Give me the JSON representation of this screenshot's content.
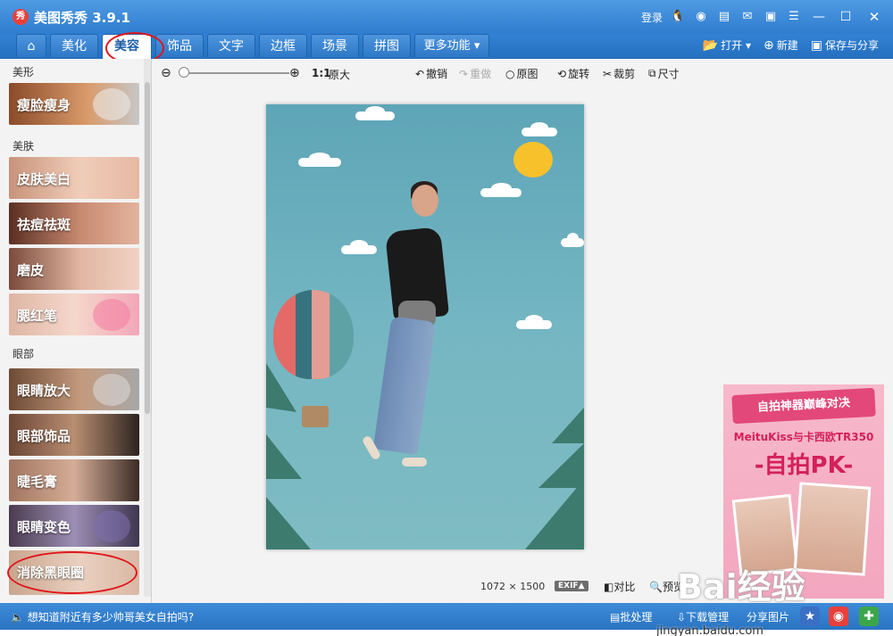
{
  "window": {
    "title": "美图秀秀 3.9.1",
    "logo_text": "秀",
    "login_label": "登录",
    "controls": {
      "minimize": "—",
      "maximize": "☐",
      "close": "✕"
    }
  },
  "nav": {
    "home_icon": "home-icon",
    "tabs": [
      "美化",
      "美容",
      "饰品",
      "文字",
      "边框",
      "场景",
      "拼图"
    ],
    "active_tab": "美容",
    "more_label": "更多功能",
    "more_caret": "▾",
    "open_label": "打开",
    "open_caret": "▾",
    "new_label": "新建",
    "save_label": "保存与分享"
  },
  "left_panel": {
    "sections": [
      {
        "label": "美形",
        "items": [
          "瘦脸瘦身"
        ]
      },
      {
        "label": "美肤",
        "items": [
          "皮肤美白",
          "祛痘祛斑",
          "磨皮",
          "腮红笔"
        ]
      },
      {
        "label": "眼部",
        "items": [
          "眼睛放大",
          "眼部饰品",
          "睫毛膏",
          "眼睛变色",
          "消除黑眼圈"
        ]
      }
    ]
  },
  "toolbar": {
    "zoom_11": "1:1",
    "zoom_orig": "原大",
    "undo": "撤销",
    "redo": "重做",
    "original": "原图",
    "rotate": "旋转",
    "crop": "裁剪",
    "size": "尺寸"
  },
  "image": {
    "width_px": "1072",
    "times": "×",
    "height_px": "1500",
    "exif_label": "EXIF▲",
    "compare_label": "对比",
    "preview_label": "预览"
  },
  "ad": {
    "banner": "自拍神器巅峰对决",
    "subtitle": "MeituKiss与卡西欧TR350",
    "headline": "-自拍PK-",
    "watermark": "Bai经验"
  },
  "status": {
    "speaker_icon": "speaker-icon",
    "message": "想知道附近有多少帅哥美女自拍吗?",
    "batch_label": "批处理",
    "download_label": "下载管理",
    "share_label": "分享图片",
    "site_watermark": "jingyan.baidu.com"
  },
  "colors": {
    "title_bar": "#3a87d6",
    "annotation_red": "#e0161b",
    "ad_pink": "#e2487a"
  }
}
